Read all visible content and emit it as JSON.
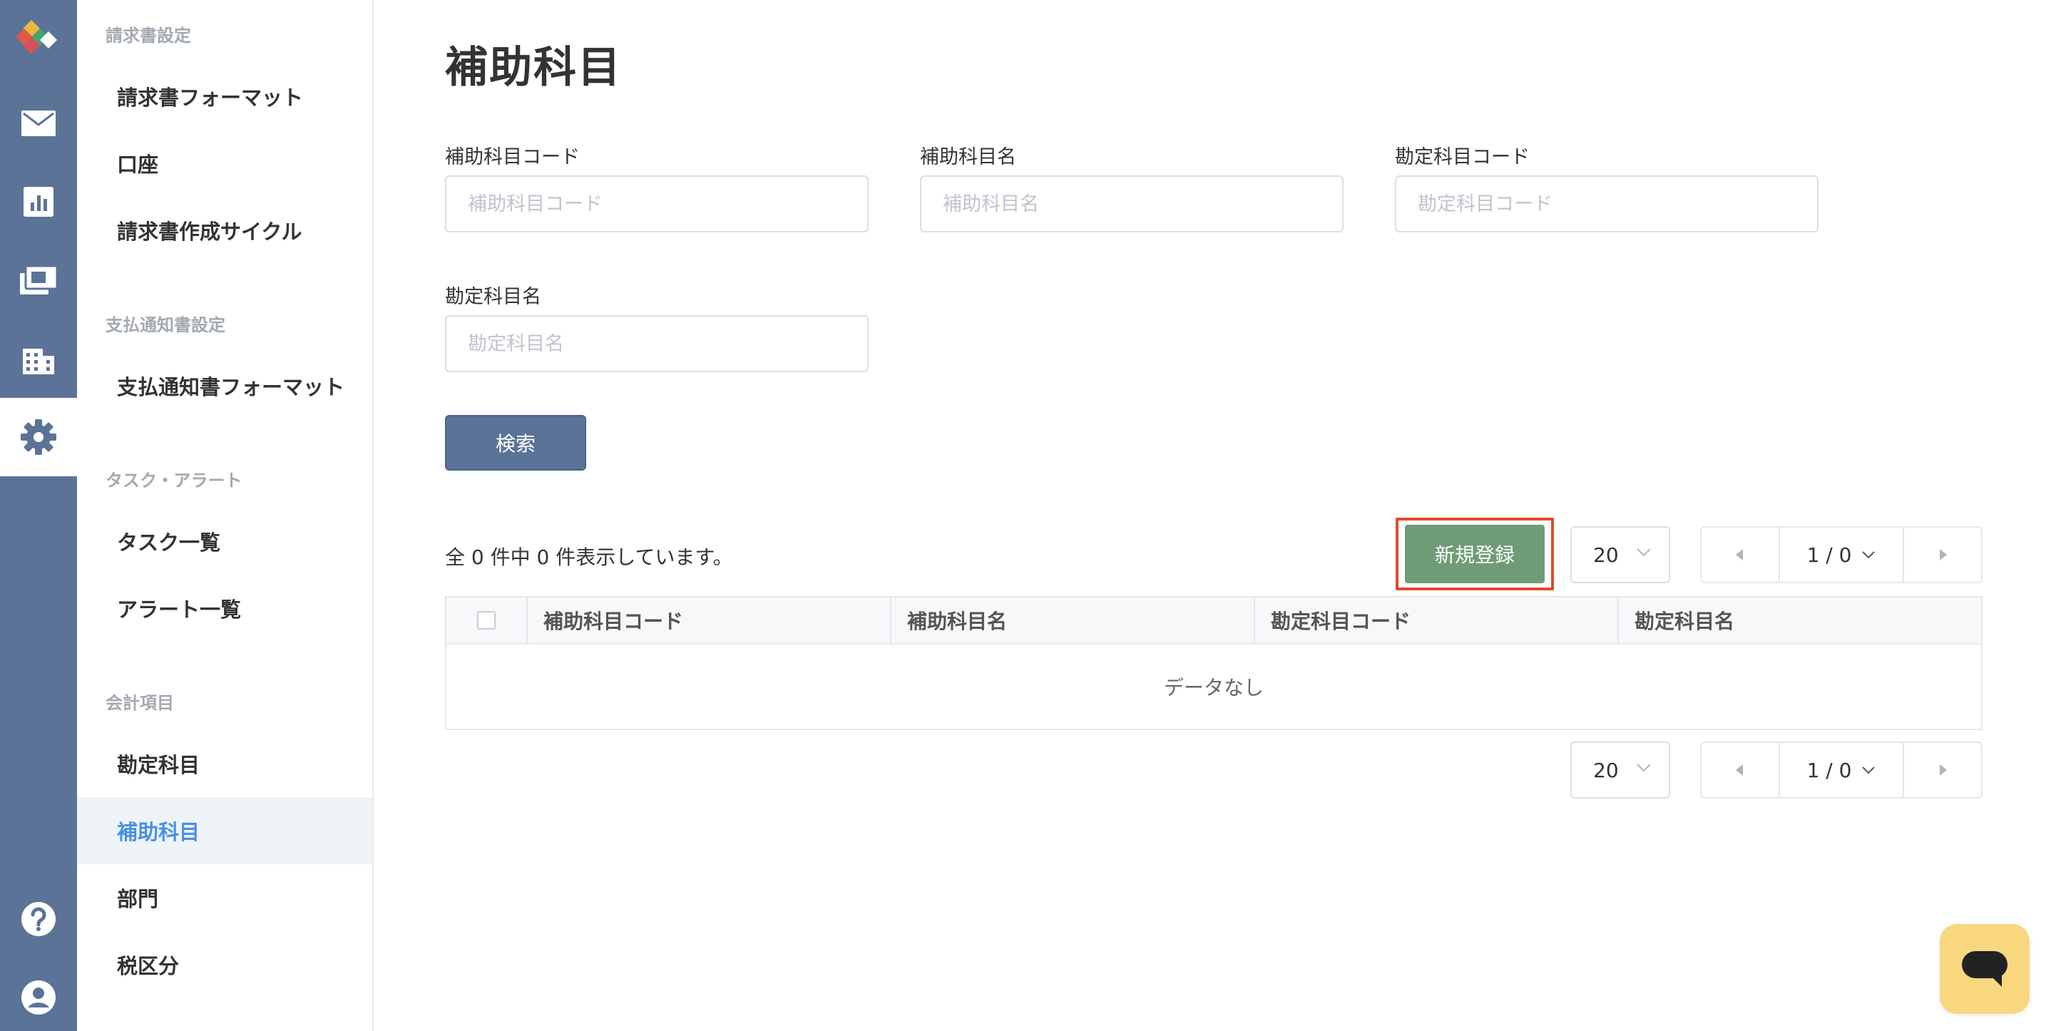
{
  "rail": {
    "items": [
      {
        "icon": "mail-icon",
        "active": false
      },
      {
        "icon": "chart-icon",
        "active": false
      },
      {
        "icon": "invoice-icon",
        "active": false
      },
      {
        "icon": "building-icon",
        "active": false
      },
      {
        "icon": "gear-icon",
        "active": true
      },
      {
        "icon": "help-icon",
        "active": false
      },
      {
        "icon": "account-icon",
        "active": false
      }
    ],
    "colors": {
      "background": "#5a7397",
      "active_background": "#ffffff"
    }
  },
  "sidebar": {
    "sections": [
      {
        "label": "請求書設定",
        "items": [
          {
            "label": "請求書フォーマット",
            "active": false
          },
          {
            "label": "口座",
            "active": false
          },
          {
            "label": "請求書作成サイクル",
            "active": false
          }
        ]
      },
      {
        "label": "支払通知書設定",
        "items": [
          {
            "label": "支払通知書フォーマット",
            "active": false
          }
        ]
      },
      {
        "label": "タスク・アラート",
        "items": [
          {
            "label": "タスク一覧",
            "active": false
          },
          {
            "label": "アラート一覧",
            "active": false
          }
        ]
      },
      {
        "label": "会計項目",
        "items": [
          {
            "label": "勘定科目",
            "active": false
          },
          {
            "label": "補助科目",
            "active": true
          },
          {
            "label": "部門",
            "active": false
          },
          {
            "label": "税区分",
            "active": false
          }
        ]
      }
    ],
    "active_color": "#4a90e2"
  },
  "page": {
    "title": "補助科目"
  },
  "filters": {
    "sub_account_code": {
      "label": "補助科目コード",
      "placeholder": "補助科目コード",
      "value": ""
    },
    "sub_account_name": {
      "label": "補助科目名",
      "placeholder": "補助科目名",
      "value": ""
    },
    "account_code": {
      "label": "勘定科目コード",
      "placeholder": "勘定科目コード",
      "value": ""
    },
    "account_name": {
      "label": "勘定科目名",
      "placeholder": "勘定科目名",
      "value": ""
    },
    "search_label": "検索"
  },
  "results": {
    "count_text": "全 0 件中 0 件表示しています。",
    "new_button_label": "新規登録",
    "new_button_color": "#6f9c76",
    "highlight_color": "#e24a2c"
  },
  "pagination_top": {
    "page_size": "20",
    "page_indicator": "1 / 0"
  },
  "pagination_bottom": {
    "page_size": "20",
    "page_indicator": "1 / 0"
  },
  "table": {
    "columns": [
      "補助科目コード",
      "補助科目名",
      "勘定科目コード",
      "勘定科目名"
    ],
    "rows": [],
    "empty_text": "データなし"
  },
  "chat": {
    "icon": "chat-icon",
    "color": "#f8d77e"
  }
}
